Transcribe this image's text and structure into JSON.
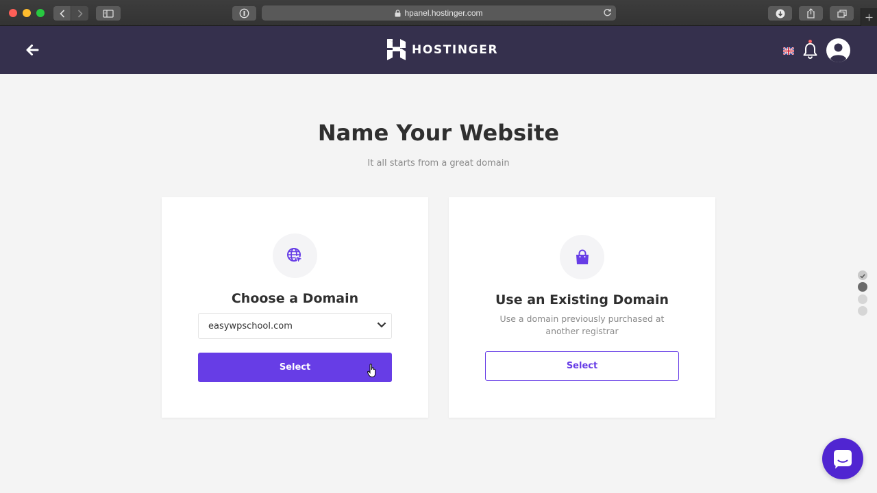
{
  "browser": {
    "url": "hpanel.hostinger.com"
  },
  "header": {
    "brand": "HOSTINGER",
    "language": "en-GB",
    "colors": {
      "background": "#35304d"
    }
  },
  "page": {
    "title": "Name Your Website",
    "subtitle": "It all starts from a great domain"
  },
  "cards": {
    "choose": {
      "icon": "globe-cursor-icon",
      "title": "Choose a Domain",
      "selected_domain": "easywpschool.com",
      "button_label": "Select"
    },
    "existing": {
      "icon": "shopping-bag-icon",
      "title": "Use an Existing Domain",
      "description": "Use a domain previously purchased at another registrar",
      "button_label": "Select"
    }
  },
  "colors": {
    "accent": "#673de6",
    "page_background": "#f4f4f4"
  }
}
